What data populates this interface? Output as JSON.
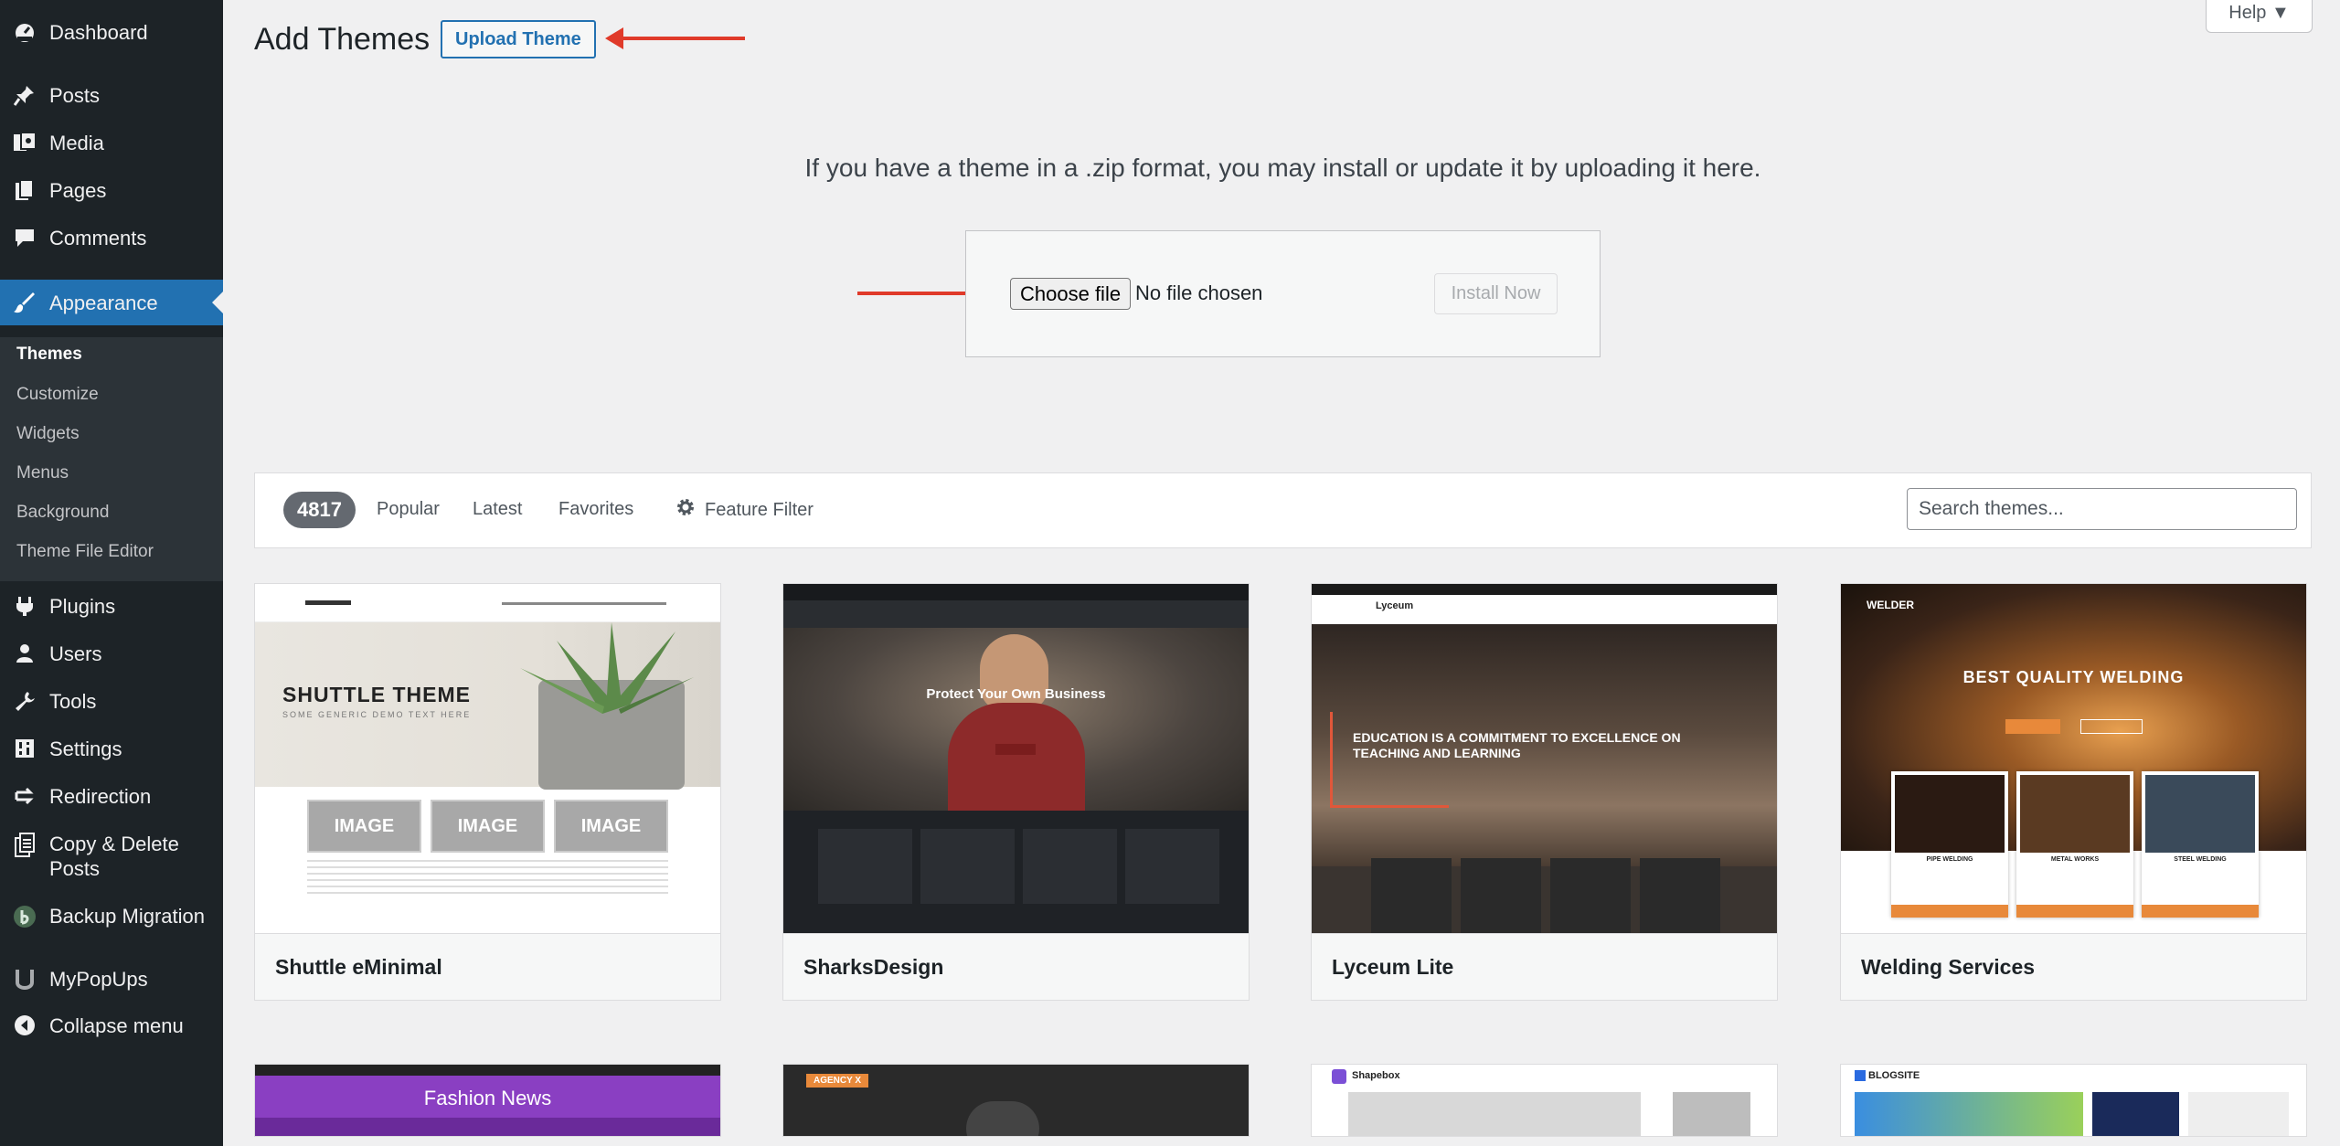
{
  "sidebar": {
    "items": [
      {
        "label": "Dashboard",
        "icon": "dashboard-icon"
      },
      {
        "label": "Posts",
        "icon": "pin-icon"
      },
      {
        "label": "Media",
        "icon": "media-icon"
      },
      {
        "label": "Pages",
        "icon": "pages-icon"
      },
      {
        "label": "Comments",
        "icon": "comment-icon"
      },
      {
        "label": "Appearance",
        "icon": "brush-icon"
      },
      {
        "label": "Plugins",
        "icon": "plugin-icon"
      },
      {
        "label": "Users",
        "icon": "user-icon"
      },
      {
        "label": "Tools",
        "icon": "wrench-icon"
      },
      {
        "label": "Settings",
        "icon": "settings-icon"
      },
      {
        "label": "Redirection",
        "icon": "redirect-icon"
      },
      {
        "label": "Copy & Delete Posts",
        "icon": "copy-icon"
      },
      {
        "label": "Backup Migration",
        "icon": "backup-icon"
      },
      {
        "label": "MyPopUps",
        "icon": "popup-icon"
      },
      {
        "label": "Collapse menu",
        "icon": "collapse-icon"
      }
    ],
    "submenu": [
      "Themes",
      "Customize",
      "Widgets",
      "Menus",
      "Background",
      "Theme File Editor"
    ]
  },
  "header": {
    "title": "Add Themes",
    "upload_button": "Upload Theme",
    "help_button": "Help ▼"
  },
  "upload": {
    "help_text": "If you have a theme in a .zip format, you may install or update it by uploading it here.",
    "choose_file": "Choose file",
    "no_file": "No file chosen",
    "install_button": "Install Now"
  },
  "filters": {
    "count": "4817",
    "popular": "Popular",
    "latest": "Latest",
    "favorites": "Favorites",
    "feature_filter": "Feature Filter",
    "search_placeholder": "Search themes..."
  },
  "themes": [
    {
      "name": "Shuttle eMinimal",
      "hero": "SHUTTLE THEME",
      "sub": "SOME GENERIC DEMO TEXT HERE",
      "image_label": "IMAGE"
    },
    {
      "name": "SharksDesign",
      "hero": "Protect Your Own Business"
    },
    {
      "name": "Lyceum Lite",
      "hero": "EDUCATION IS A COMMITMENT TO EXCELLENCE ON TEACHING AND LEARNING",
      "brand": "Lyceum"
    },
    {
      "name": "Welding Services",
      "hero": "BEST QUALITY WELDING",
      "brand": "WELDER",
      "cards": [
        "PIPE WELDING",
        "METAL WORKS",
        "STEEL WELDING"
      ]
    }
  ],
  "themes_row2": [
    {
      "hero": "Fashion News"
    },
    {
      "badge": "AGENCY X"
    },
    {
      "brand": "Shapebox"
    },
    {
      "brand": "BLOGSITE"
    }
  ],
  "colors": {
    "sidebar_bg": "#1d2327",
    "accent": "#2271b1",
    "annotation_arrow": "#e03a2a"
  }
}
